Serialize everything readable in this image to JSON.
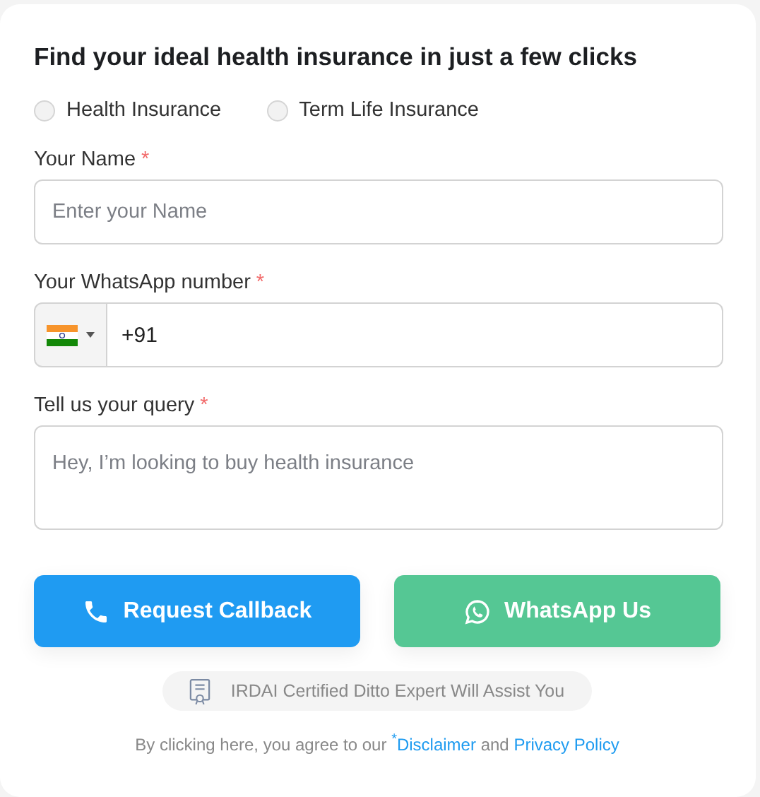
{
  "title": "Find your ideal health insurance in just a few clicks",
  "insurance_types": [
    {
      "label": "Health Insurance",
      "selected": false
    },
    {
      "label": "Term Life Insurance",
      "selected": false
    }
  ],
  "fields": [
    {
      "kind": "text",
      "label": "Your Name",
      "required_mark": "*",
      "placeholder": "Enter your Name"
    },
    {
      "kind": "phone",
      "label": "Your WhatsApp number",
      "required_mark": "*",
      "value": "+91"
    },
    {
      "kind": "textarea",
      "label": "Tell us your query",
      "required_mark": "*",
      "placeholder": "Hey, I’m looking to buy health insurance"
    }
  ],
  "buttons": [
    {
      "kind": "call",
      "label": "Request Callback"
    },
    {
      "kind": "whatsapp",
      "label": "WhatsApp Us"
    }
  ],
  "badge": "IRDAI Certified Ditto Expert Will Assist You",
  "footer": {
    "text": "By clicking here, you agree to our",
    "disclaimer": "$^{*}$Disclaimer",
    "joiner": "and",
    "privacy": "Privacy Policy"
  }
}
